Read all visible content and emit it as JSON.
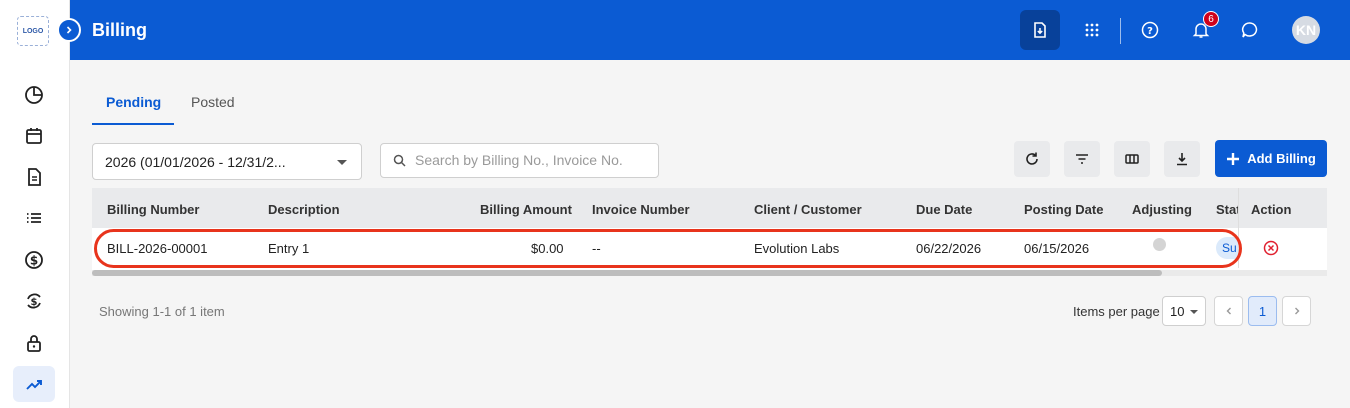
{
  "sidebar": {
    "logo_text": "LOGO",
    "items": [
      {
        "name": "dashboard",
        "icon": "pie-chart-icon"
      },
      {
        "name": "calendar",
        "icon": "calendar-icon"
      },
      {
        "name": "documents",
        "icon": "document-icon"
      },
      {
        "name": "list",
        "icon": "list-icon"
      },
      {
        "name": "billing",
        "icon": "dollar-icon"
      },
      {
        "name": "exchange",
        "icon": "currency-exchange-icon"
      },
      {
        "name": "security",
        "icon": "lock-icon"
      },
      {
        "name": "reports",
        "icon": "trending-up-icon",
        "active": true
      }
    ]
  },
  "header": {
    "title": "Billing",
    "notification_count": "6",
    "avatar_initials": "KN",
    "brand_color": "#0b5bd3"
  },
  "tabs": [
    {
      "label": "Pending",
      "active": true
    },
    {
      "label": "Posted",
      "active": false
    }
  ],
  "filters": {
    "year_value": "2026 (01/01/2026 - 12/31/2...",
    "search_placeholder": "Search by Billing No., Invoice No."
  },
  "toolbar": {
    "add_label": "Add Billing"
  },
  "table": {
    "columns": [
      "Billing Number",
      "Description",
      "Billing Amount",
      "Invoice Number",
      "Client / Customer",
      "Due Date",
      "Posting Date",
      "Adjusting",
      "Stat",
      "Action"
    ],
    "rows": [
      {
        "billing_number": "BILL-2026-00001",
        "description": "Entry 1",
        "billing_amount": "$0.00",
        "invoice_number": "--",
        "client": "Evolution Labs",
        "due_date": "06/22/2026",
        "posting_date": "06/15/2026",
        "status": "Su"
      }
    ]
  },
  "footer": {
    "showing": "Showing 1-1 of 1 item",
    "items_per_page_label": "Items per page",
    "items_per_page": "10",
    "current_page": "1"
  }
}
